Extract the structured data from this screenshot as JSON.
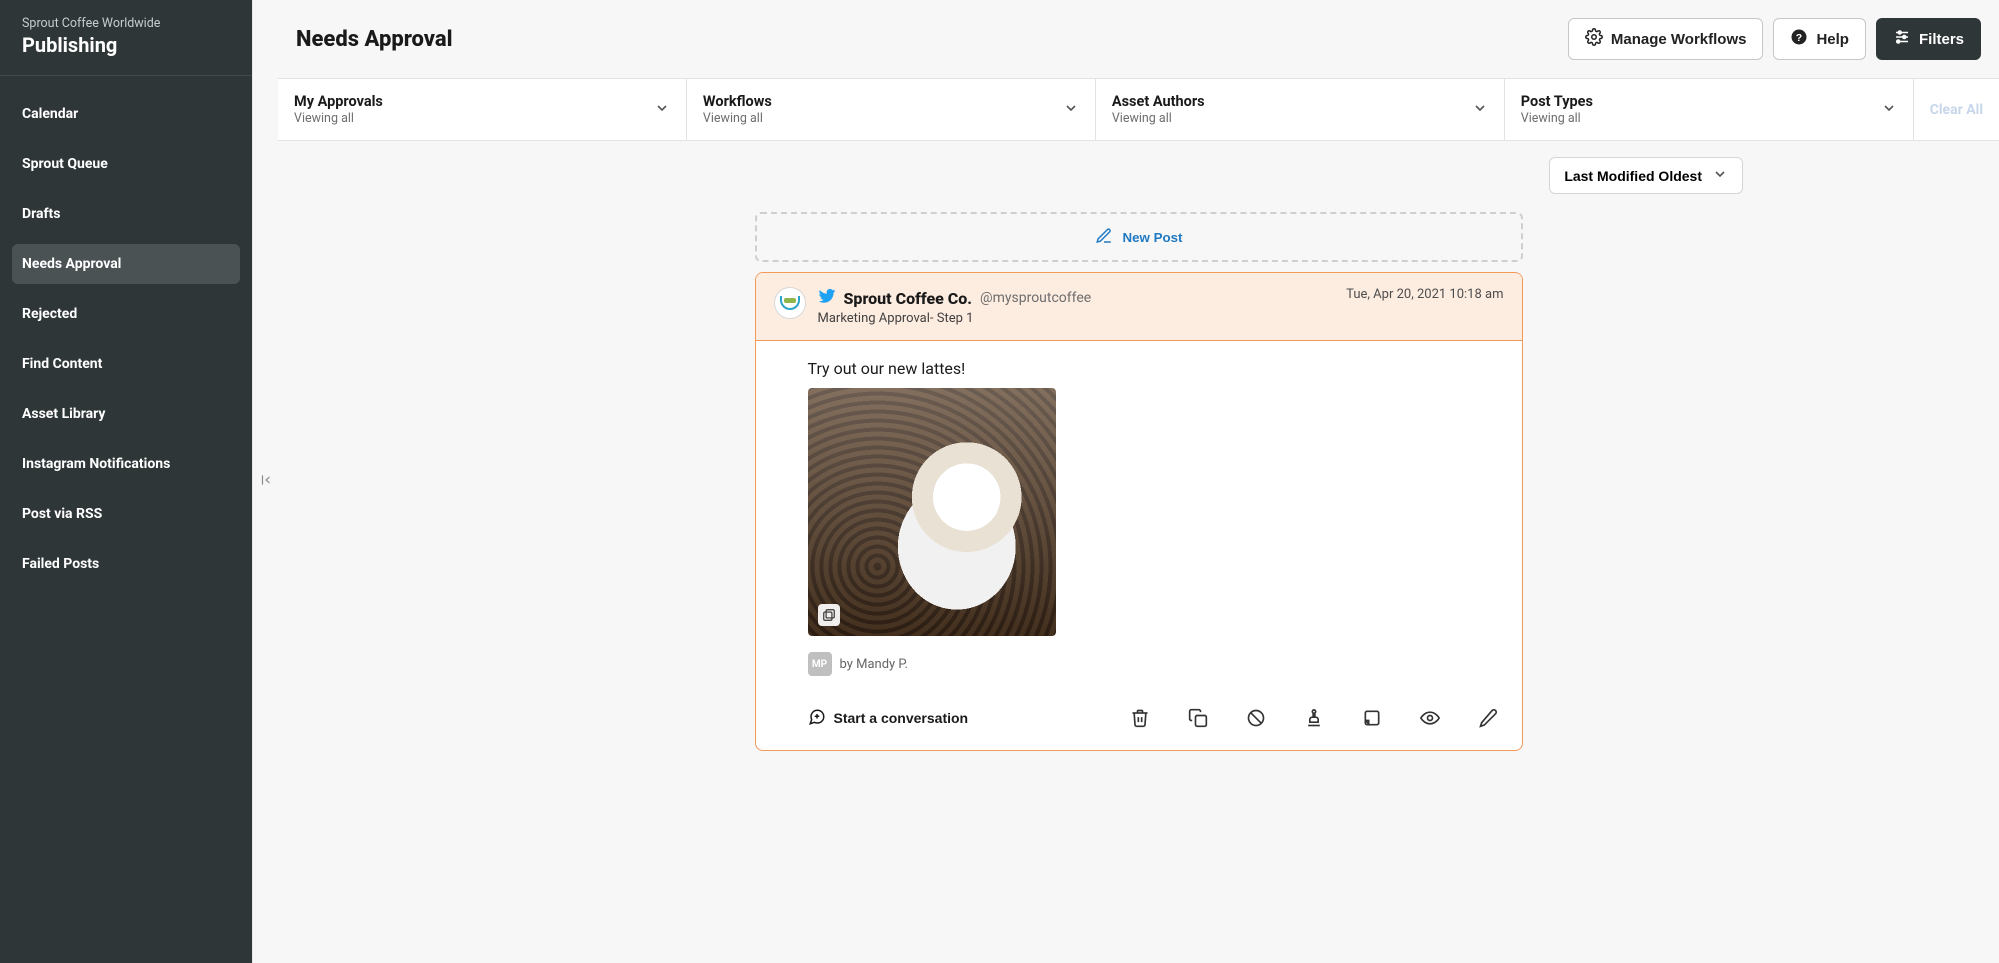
{
  "sidebar": {
    "org": "Sprout Coffee Worldwide",
    "app": "Publishing",
    "items": [
      {
        "label": "Calendar",
        "active": false
      },
      {
        "label": "Sprout Queue",
        "active": false
      },
      {
        "label": "Drafts",
        "active": false
      },
      {
        "label": "Needs Approval",
        "active": true
      },
      {
        "label": "Rejected",
        "active": false
      },
      {
        "label": "Find Content",
        "active": false
      },
      {
        "label": "Asset Library",
        "active": false
      },
      {
        "label": "Instagram Notifications",
        "active": false
      },
      {
        "label": "Post via RSS",
        "active": false
      },
      {
        "label": "Failed Posts",
        "active": false
      }
    ]
  },
  "header": {
    "title": "Needs Approval",
    "manage_workflows": "Manage Workflows",
    "help": "Help",
    "filters": "Filters"
  },
  "filters": {
    "cells": [
      {
        "label": "My Approvals",
        "sub": "Viewing all"
      },
      {
        "label": "Workflows",
        "sub": "Viewing all"
      },
      {
        "label": "Asset Authors",
        "sub": "Viewing all"
      },
      {
        "label": "Post Types",
        "sub": "Viewing all"
      }
    ],
    "clear_all": "Clear All"
  },
  "sort": {
    "label": "Last Modified Oldest"
  },
  "new_post": "New Post",
  "post": {
    "account_name": "Sprout Coffee Co.",
    "account_handle": "@mysproutcoffee",
    "workflow": "Marketing Approval- Step 1",
    "timestamp": "Tue, Apr 20, 2021 10:18 am",
    "text": "Try out our new lattes!",
    "author_initials": "MP",
    "byline": "by Mandy P.",
    "start_conversation": "Start a conversation"
  }
}
